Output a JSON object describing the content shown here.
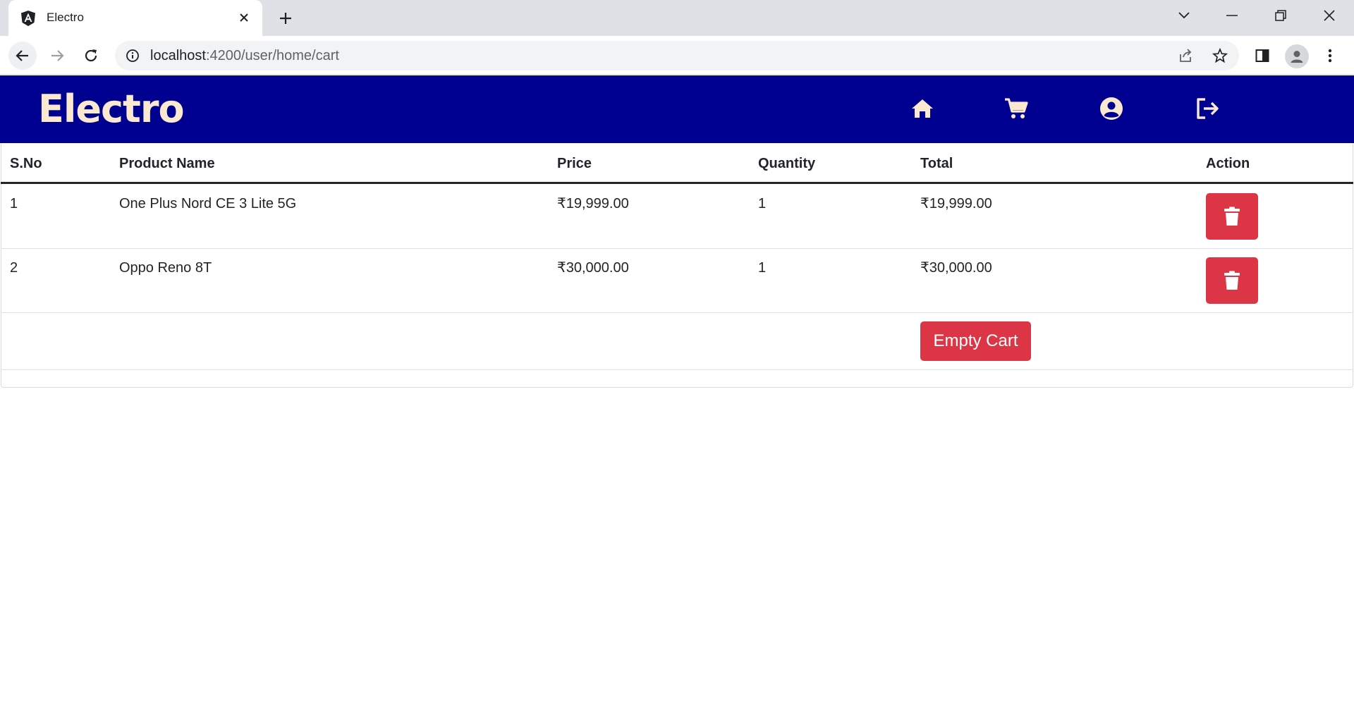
{
  "browser": {
    "tab_title": "Electro",
    "url_host": "localhost",
    "url_rest": ":4200/user/home/cart"
  },
  "header": {
    "brand": "Electro",
    "nav_icons": [
      "home-icon",
      "cart-icon",
      "account-icon",
      "logout-icon"
    ]
  },
  "cart": {
    "columns": [
      "S.No",
      "Product Name",
      "Price",
      "Quantity",
      "Total",
      "Action"
    ],
    "rows": [
      {
        "sno": "1",
        "name": "One Plus Nord CE 3 Lite 5G",
        "price": "₹19,999.00",
        "qty": "1",
        "total": "₹19,999.00"
      },
      {
        "sno": "2",
        "name": "Oppo Reno 8T",
        "price": "₹30,000.00",
        "qty": "1",
        "total": "₹30,000.00"
      }
    ],
    "empty_label": "Empty Cart"
  },
  "colors": {
    "header_bg": "#000090",
    "brand": "#fbe8d0",
    "danger": "#dc3545"
  }
}
